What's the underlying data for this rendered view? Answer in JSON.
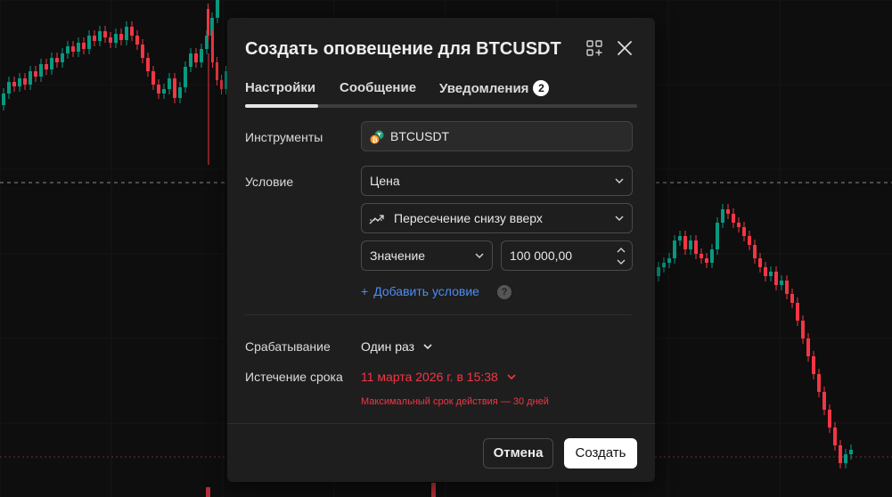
{
  "dialog": {
    "title": "Создать оповещение для BTCUSDT",
    "header_icons": [
      "add-to-layout-icon",
      "close-icon"
    ]
  },
  "tabs": [
    {
      "label": "Настройки",
      "active": true
    },
    {
      "label": "Сообщение",
      "active": false
    },
    {
      "label": "Уведомления",
      "badge": "2",
      "active": false
    }
  ],
  "instruments": {
    "label": "Инструменты",
    "value": "BTCUSDT",
    "icon": "bitcoin-tether-pair-icon"
  },
  "condition": {
    "label": "Условие",
    "source": "Цена",
    "operator": "Пересечение снизу вверх",
    "operator_icon": "crossing-up-icon",
    "value_type": "Значение",
    "value": "100 000,00",
    "add_label": "Добавить условие",
    "help": "?"
  },
  "trigger": {
    "label": "Срабатывание",
    "value": "Один раз"
  },
  "expiration": {
    "label": "Истечение срока",
    "value": "11 марта 2026 г. в 15:38",
    "warning": "Максимальный срок действия — 30 дней"
  },
  "buttons": {
    "cancel": "Отмена",
    "create": "Создать"
  },
  "colors": {
    "background": "#0e0e0e",
    "dialog": "#1e1e1e",
    "bullish": "#089981",
    "bearish": "#f23645",
    "accent": "#4c8cf5",
    "warning": "#f23645"
  }
}
